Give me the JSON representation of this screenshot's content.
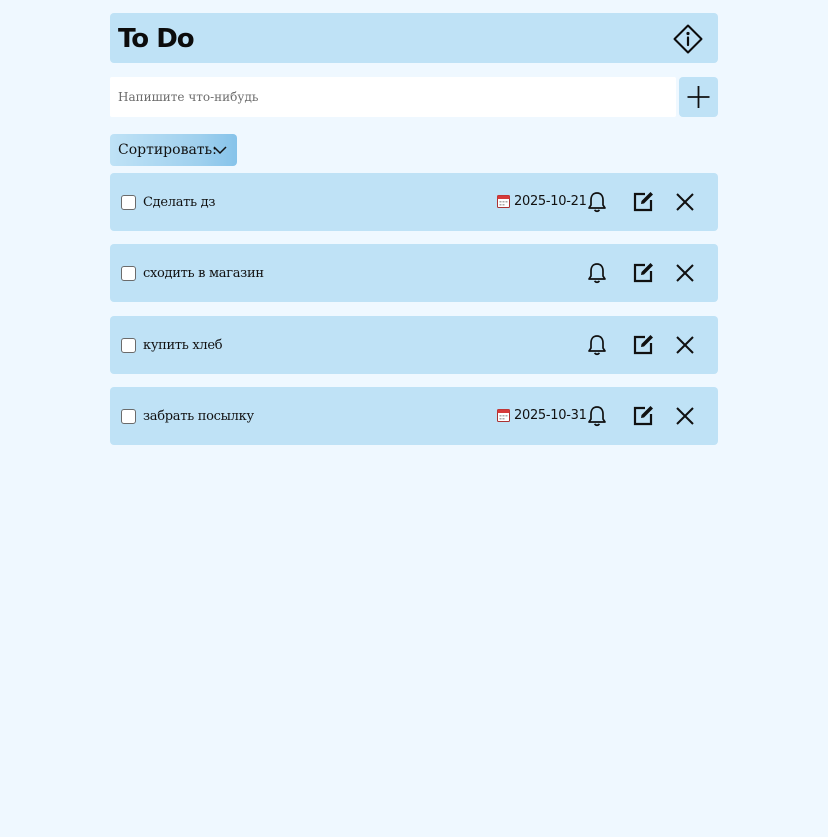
{
  "header": {
    "title": "To Do",
    "info_icon": "info-diamond-icon"
  },
  "new_task": {
    "placeholder": "Напишите что-нибудь",
    "value": "",
    "add_icon": "plus-icon"
  },
  "sort": {
    "label": "Сортировать:",
    "icon": "chevron-down-icon"
  },
  "tasks": [
    {
      "text": "Сделать дз",
      "checked": false,
      "due_date": "2025-10-21"
    },
    {
      "text": "сходить в магазин",
      "checked": false,
      "due_date": ""
    },
    {
      "text": "купить хлеб",
      "checked": false,
      "due_date": ""
    },
    {
      "text": "забрать посылку",
      "checked": false,
      "due_date": "2025-10-31"
    }
  ],
  "task_icons": [
    "calendar-icon",
    "bell-icon",
    "edit-icon",
    "close-icon"
  ],
  "colors": {
    "background": "#eff8ff",
    "panel": "#bfe2f6",
    "accent": "#86c3ea"
  }
}
